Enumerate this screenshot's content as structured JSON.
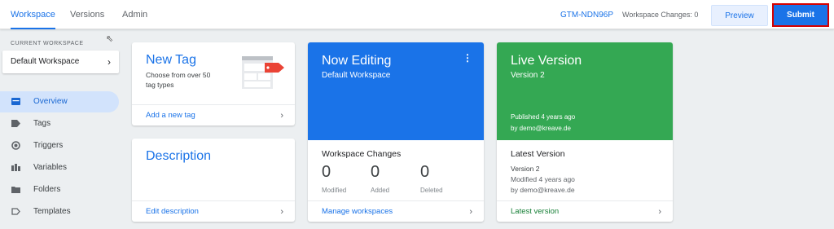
{
  "header": {
    "tabs": [
      {
        "label": "Workspace",
        "active": true
      },
      {
        "label": "Versions",
        "active": false
      },
      {
        "label": "Admin",
        "active": false
      }
    ],
    "container_id": "GTM-NDN96P",
    "workspace_changes": "Workspace Changes: 0",
    "preview_label": "Preview",
    "submit_label": "Submit"
  },
  "sidebar": {
    "current_workspace_label": "CURRENT WORKSPACE",
    "workspace_name": "Default Workspace",
    "items": [
      {
        "label": "Overview",
        "icon": "overview-icon",
        "active": true
      },
      {
        "label": "Tags",
        "icon": "tag-icon",
        "active": false
      },
      {
        "label": "Triggers",
        "icon": "trigger-icon",
        "active": false
      },
      {
        "label": "Variables",
        "icon": "variables-icon",
        "active": false
      },
      {
        "label": "Folders",
        "icon": "folder-icon",
        "active": false
      },
      {
        "label": "Templates",
        "icon": "template-icon",
        "active": false
      }
    ]
  },
  "cards": {
    "new_tag": {
      "title": "New Tag",
      "description_line1": "Choose from over 50",
      "description_line2": "tag types",
      "link": "Add a new tag"
    },
    "description": {
      "title": "Description",
      "link": "Edit description"
    },
    "now_editing": {
      "title": "Now Editing",
      "workspace": "Default Workspace",
      "changes_title": "Workspace Changes",
      "stats": [
        {
          "value": "0",
          "label": "Modified"
        },
        {
          "value": "0",
          "label": "Added"
        },
        {
          "value": "0",
          "label": "Deleted"
        }
      ],
      "link": "Manage workspaces",
      "color": "#1a73e8"
    },
    "live_version": {
      "title": "Live Version",
      "version": "Version 2",
      "published": "Published 4 years ago",
      "published_by": "by demo@kreave.de",
      "latest_title": "Latest Version",
      "latest_version": "Version 2",
      "modified": "Modified 4 years ago",
      "modified_by": "by demo@kreave.de",
      "link": "Latest version",
      "color": "#34a853"
    }
  }
}
